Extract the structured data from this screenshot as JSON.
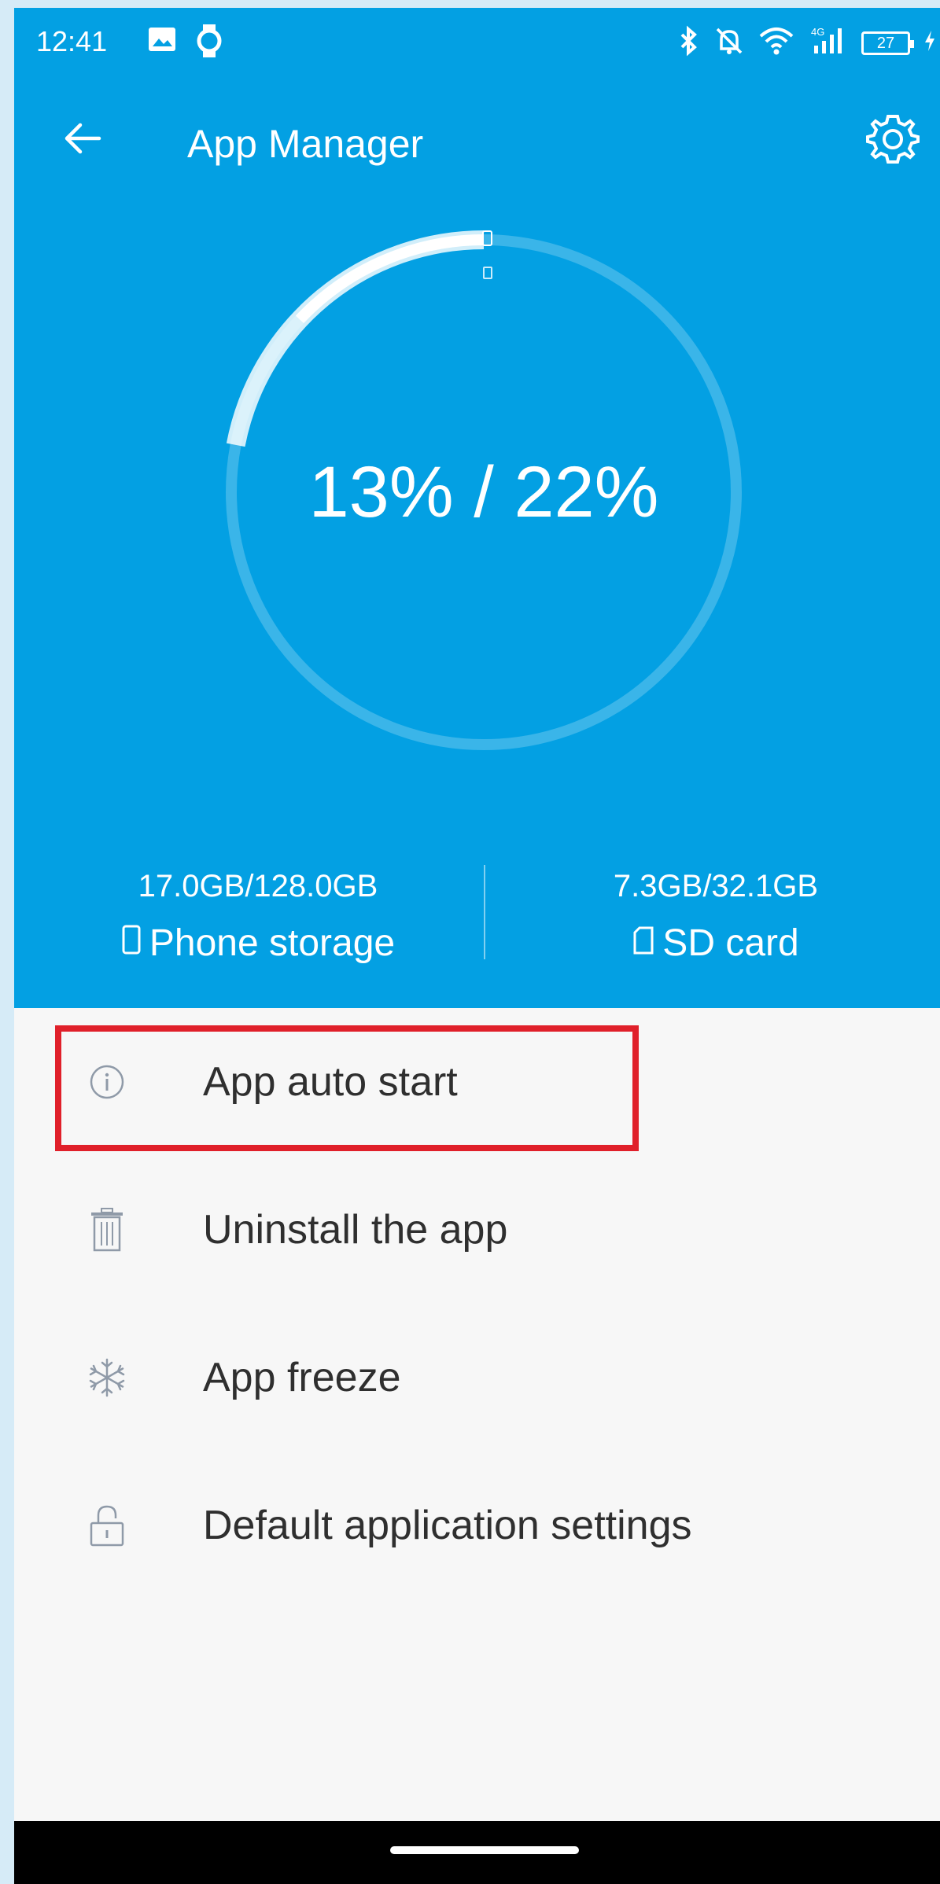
{
  "status_bar": {
    "time": "12:41",
    "battery": "27"
  },
  "header": {
    "title": "App Manager"
  },
  "usage": {
    "text": "13% / 22%",
    "phone_fraction": 0.13,
    "sd_fraction": 0.22
  },
  "storage": {
    "phone": {
      "amount": "17.0GB/128.0GB",
      "label": "Phone storage"
    },
    "sd": {
      "amount": "7.3GB/32.1GB",
      "label": "SD card"
    }
  },
  "menu": [
    {
      "label": "App auto start",
      "icon": "info-icon"
    },
    {
      "label": "Uninstall the app",
      "icon": "trash-icon"
    },
    {
      "label": "App freeze",
      "icon": "snowflake-icon"
    },
    {
      "label": "Default application settings",
      "icon": "lock-icon"
    }
  ],
  "colors": {
    "header": "#03a0e3",
    "highlight": "#e0202a"
  }
}
